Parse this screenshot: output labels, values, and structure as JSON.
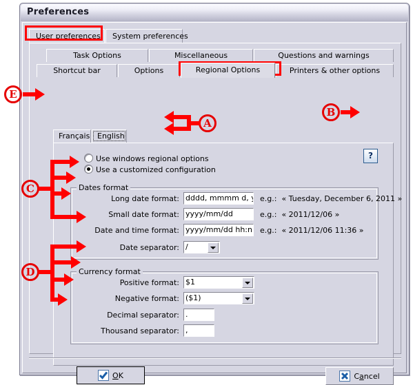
{
  "window": {
    "title": "Preferences"
  },
  "outer_tabs": [
    {
      "label": "User preferences",
      "selected": true
    },
    {
      "label": "System preferences",
      "selected": false
    }
  ],
  "inner_tabs_row1": [
    {
      "label": "Task Options",
      "selected": false
    },
    {
      "label": "Miscellaneous",
      "selected": false
    },
    {
      "label": "Questions and warnings",
      "selected": false
    }
  ],
  "inner_tabs_row2": [
    {
      "label": "Shortcut bar",
      "selected": false
    },
    {
      "label": "Options",
      "selected": false
    },
    {
      "label": "Regional Options",
      "selected": true
    },
    {
      "label": "Printers & other options",
      "selected": false
    }
  ],
  "language_tabs": [
    {
      "label": "Français",
      "selected": false
    },
    {
      "label": "English",
      "selected": true
    }
  ],
  "mode_radios": [
    {
      "label": "Use windows regional options",
      "selected": false
    },
    {
      "label": "Use a customized configuration",
      "selected": true
    }
  ],
  "help_button": {
    "label": "?",
    "icon": "question-mark-icon"
  },
  "dates_format": {
    "title": "Dates format",
    "fields": [
      {
        "label": "Long date format:",
        "value": "dddd, mmmm d, yyyy",
        "example_prefix": "e.g.:",
        "example": "« Tuesday, December 6, 2011 »",
        "control": "textbox"
      },
      {
        "label": "Small date format:",
        "value": "yyyy/mm/dd",
        "example_prefix": "e.g.:",
        "example": "« 2011/12/06 »",
        "control": "textbox"
      },
      {
        "label": "Date and time format:",
        "value": "yyyy/mm/dd hh:nn",
        "example_prefix": "e.g.:",
        "example": "« 2011/12/06 11:36 »",
        "control": "textbox"
      },
      {
        "label": "Date separator:",
        "value": "/",
        "example_prefix": "",
        "example": "",
        "control": "combobox"
      }
    ]
  },
  "currency_format": {
    "title": "Currency format",
    "fields": [
      {
        "label": "Positive format:",
        "value": "$1",
        "control": "combobox"
      },
      {
        "label": "Negative format:",
        "value": "($1)",
        "control": "combobox"
      },
      {
        "label": "Decimal separator:",
        "value": ".",
        "control": "textbox"
      },
      {
        "label": "Thousand separator:",
        "value": ",",
        "control": "textbox"
      }
    ]
  },
  "buttons": {
    "ok": {
      "label_pre": "",
      "label_accel": "O",
      "label_post": "K",
      "icon": "checkmark-icon"
    },
    "cancel": {
      "label_pre": "C",
      "label_accel": "a",
      "label_post": "ncel",
      "icon": "cross-icon"
    }
  },
  "annotations": {
    "a": "A",
    "b": "B",
    "c": "C",
    "d": "D",
    "e": "E"
  },
  "colors": {
    "annotation_red": "#ff0000",
    "window_face": "#d6d6e2",
    "help_blue": "#0d2f63"
  }
}
